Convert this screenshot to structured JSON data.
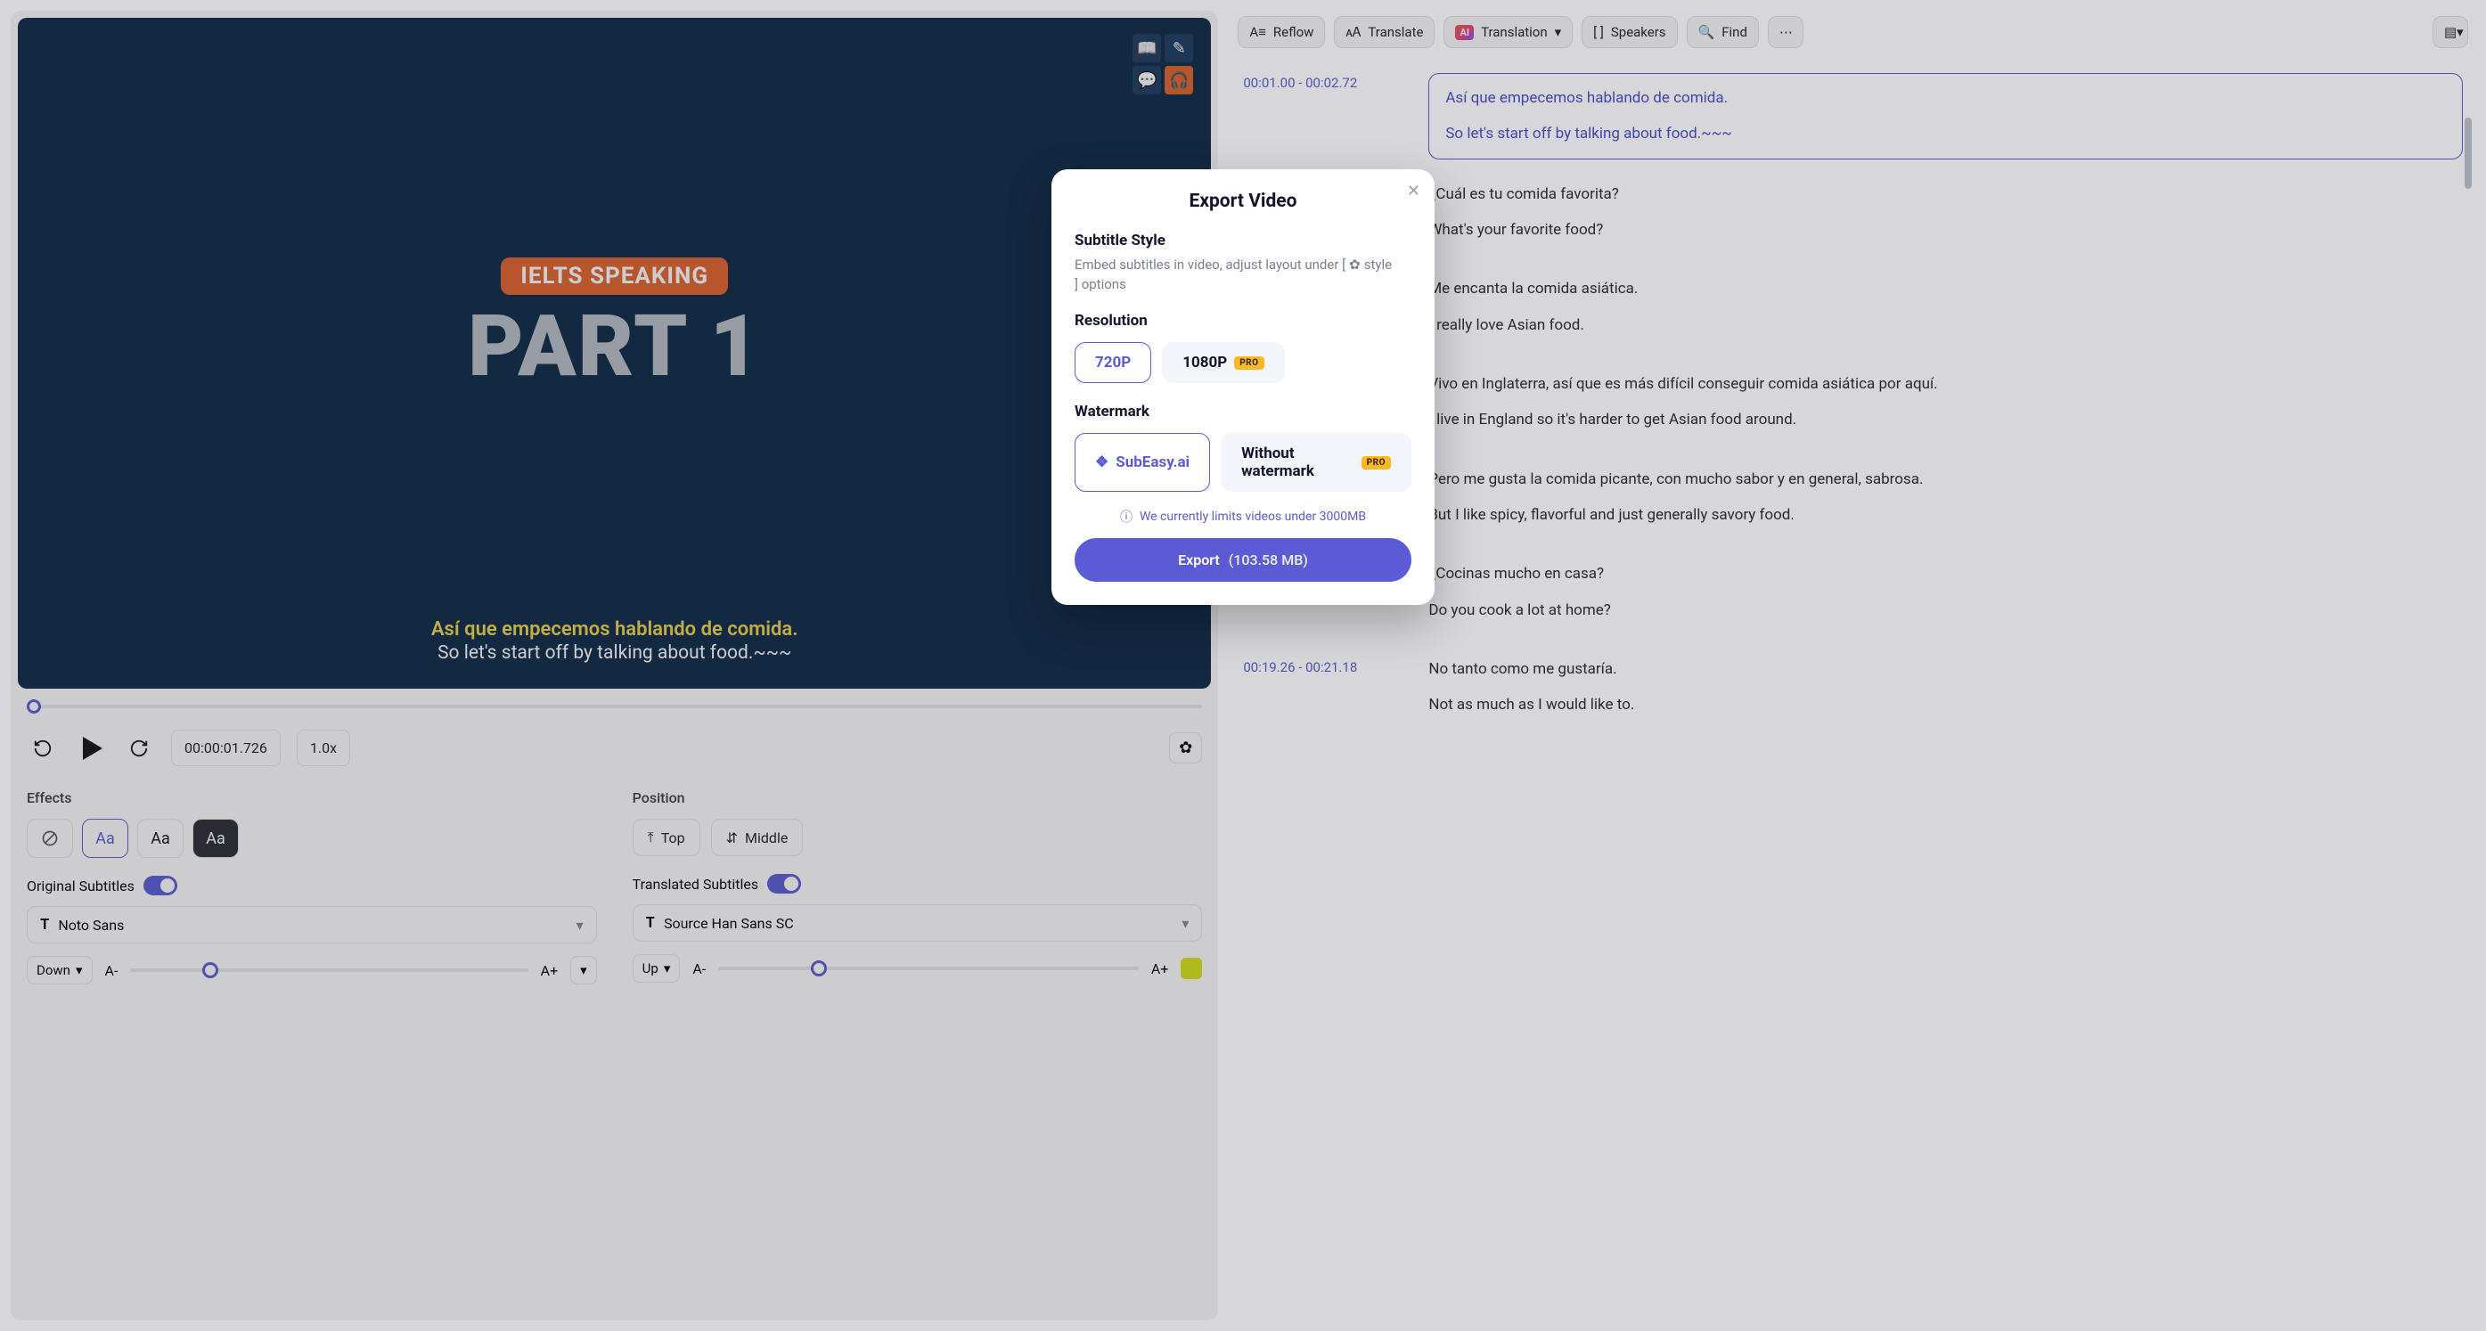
{
  "video": {
    "title_chip": "IELTS SPEAKING",
    "title_big": "PART 1",
    "subtitle_top": "Así que empecemos hablando de comida.",
    "subtitle_bottom": "So let's start off by talking about food.~~~",
    "current_time": "00:00:01.726",
    "speed": "1.0x"
  },
  "effects": {
    "label": "Effects",
    "options": [
      "none",
      "light-outline",
      "plain",
      "dark-box"
    ],
    "icon_text": "Aa"
  },
  "position": {
    "label": "Position",
    "options": [
      {
        "label": "Top"
      },
      {
        "label": "Middle"
      }
    ]
  },
  "original_subs": {
    "label": "Original Subtitles",
    "font": "Noto Sans",
    "direction": "Down",
    "size_minus": "A-",
    "size_plus": "A+"
  },
  "translated_subs": {
    "label": "Translated Subtitles",
    "font": "Source Han Sans SC",
    "direction": "Up",
    "size_minus": "A-",
    "size_plus": "A+",
    "color": "#d9e617"
  },
  "toolbar": {
    "reflow": "Reflow",
    "translate": "Translate",
    "translation": "Translation",
    "speakers": "Speakers",
    "find": "Find"
  },
  "transcript": [
    {
      "time": "00:01.00  -  00:02.72",
      "active": true,
      "lines": [
        "Así que empecemos hablando de comida.",
        "So let's start off by talking about food.~~~"
      ]
    },
    {
      "time": "",
      "lines": [
        "¿Cuál es tu comida favorita?",
        "What's your favorite food?"
      ]
    },
    {
      "time": "",
      "lines": [
        "Me encanta la comida asiática.",
        "I really love Asian food."
      ]
    },
    {
      "time": "",
      "lines": [
        "Vivo en Inglaterra, así que es más difícil conseguir comida asiática por aquí.",
        "I live in England so it's harder to get Asian food around."
      ]
    },
    {
      "time": "",
      "lines": [
        "Pero me gusta la comida picante, con mucho sabor y en general, sabrosa.",
        "But I like spicy, flavorful and just generally savory food."
      ]
    },
    {
      "time": "",
      "lines": [
        "¿Cocinas mucho en casa?",
        "Do you cook a lot at home?"
      ]
    },
    {
      "time": "00:19.26  -  00:21.18",
      "lines": [
        "No tanto como me gustaría.",
        "Not as much as I would like to."
      ]
    }
  ],
  "modal": {
    "title": "Export Video",
    "subtitle_style_label": "Subtitle Style",
    "subtitle_style_desc_pre": "Embed subtitles in video, adjust layout under [",
    "subtitle_style_desc_mid": " style",
    "subtitle_style_desc_post": "] options",
    "resolution_label": "Resolution",
    "res_720": "720P",
    "res_1080": "1080P",
    "pro": "PRO",
    "watermark_label": "Watermark",
    "wm_with": "SubEasy.ai",
    "wm_without": "Without watermark",
    "limit_text": "We currently limits videos under 3000MB",
    "export_label": "Export",
    "export_size": "(103.58 MB)"
  }
}
